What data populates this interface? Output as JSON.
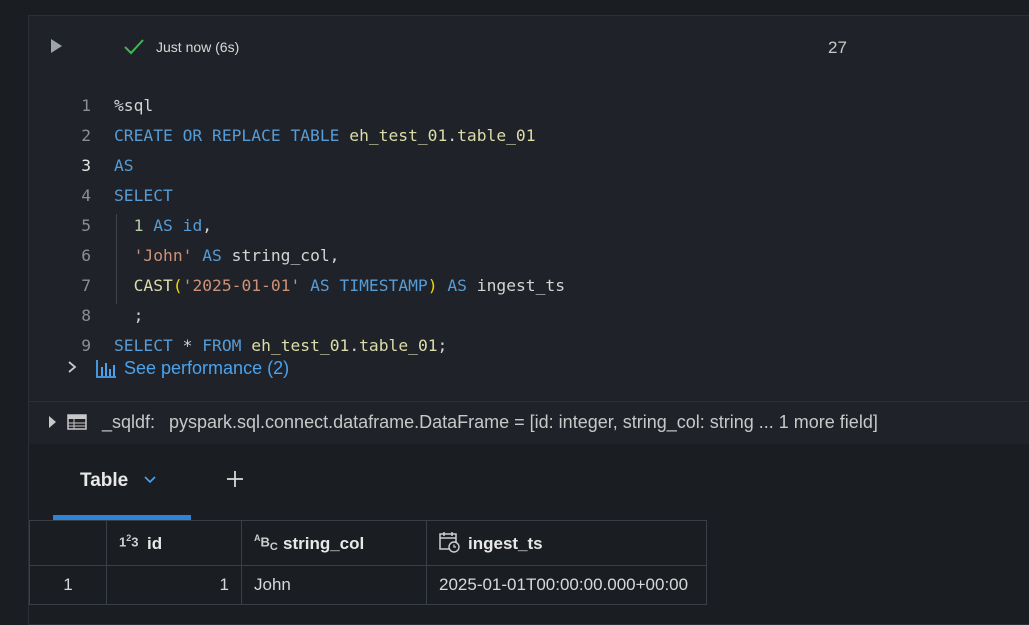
{
  "cell": {
    "status": "Just now (6s)",
    "number": "27"
  },
  "code_lines": [
    {
      "n": "1",
      "tokens": [
        {
          "c": "txt",
          "t": "%sql"
        }
      ]
    },
    {
      "n": "2",
      "tokens": [
        {
          "c": "kw",
          "t": "CREATE OR REPLACE TABLE "
        },
        {
          "c": "id",
          "t": "eh_test_01"
        },
        {
          "c": "txt",
          "t": "."
        },
        {
          "c": "id",
          "t": "table_01"
        }
      ]
    },
    {
      "n": "3",
      "active": true,
      "tokens": [
        {
          "c": "kw",
          "t": "AS"
        }
      ]
    },
    {
      "n": "4",
      "tokens": [
        {
          "c": "kw",
          "t": "SELECT"
        }
      ]
    },
    {
      "n": "5",
      "tokens": [
        {
          "c": "txt",
          "t": "  "
        },
        {
          "c": "num",
          "t": "1"
        },
        {
          "c": "txt",
          "t": " "
        },
        {
          "c": "kw",
          "t": "AS"
        },
        {
          "c": "txt",
          "t": " "
        },
        {
          "c": "kw",
          "t": "id"
        },
        {
          "c": "txt",
          "t": ","
        }
      ]
    },
    {
      "n": "6",
      "tokens": [
        {
          "c": "txt",
          "t": "  "
        },
        {
          "c": "str",
          "t": "'John'"
        },
        {
          "c": "txt",
          "t": " "
        },
        {
          "c": "kw",
          "t": "AS"
        },
        {
          "c": "txt",
          "t": " string_col,"
        }
      ]
    },
    {
      "n": "7",
      "tokens": [
        {
          "c": "txt",
          "t": "  "
        },
        {
          "c": "id",
          "t": "CAST"
        },
        {
          "c": "paren",
          "t": "("
        },
        {
          "c": "str",
          "t": "'2025-01-01'"
        },
        {
          "c": "txt",
          "t": " "
        },
        {
          "c": "kw",
          "t": "AS"
        },
        {
          "c": "txt",
          "t": " "
        },
        {
          "c": "kw",
          "t": "TIMESTAMP"
        },
        {
          "c": "paren",
          "t": ")"
        },
        {
          "c": "txt",
          "t": " "
        },
        {
          "c": "kw",
          "t": "AS"
        },
        {
          "c": "txt",
          "t": " ingest_ts"
        }
      ]
    },
    {
      "n": "8",
      "tokens": [
        {
          "c": "txt",
          "t": "  ;"
        }
      ]
    },
    {
      "n": "9",
      "tokens": [
        {
          "c": "kw",
          "t": "SELECT"
        },
        {
          "c": "txt",
          "t": " * "
        },
        {
          "c": "kw",
          "t": "FROM"
        },
        {
          "c": "txt",
          "t": " "
        },
        {
          "c": "id",
          "t": "eh_test_01"
        },
        {
          "c": "txt",
          "t": "."
        },
        {
          "c": "id",
          "t": "table_01"
        },
        {
          "c": "txt",
          "t": ";"
        }
      ]
    }
  ],
  "performance": {
    "label": "See performance (2)"
  },
  "dataframe": {
    "name": "_sqldf:",
    "type": "pyspark.sql.connect.dataframe.DataFrame = [id: integer, string_col: string ... 1 more field]"
  },
  "results": {
    "tab_label": "Table",
    "columns": [
      {
        "icon": "1²3",
        "label": "id"
      },
      {
        "icon": "ᴬBc",
        "label": "string_col"
      },
      {
        "icon": "cal",
        "label": "ingest_ts"
      }
    ],
    "rows": [
      {
        "index": "1",
        "id": "1",
        "string_col": "John",
        "ingest_ts": "2025-01-01T00:00:00.000+00:00"
      }
    ]
  },
  "colors": {
    "accent": "#2f82d6",
    "link": "#4aa3ef",
    "success": "#3fb950"
  }
}
